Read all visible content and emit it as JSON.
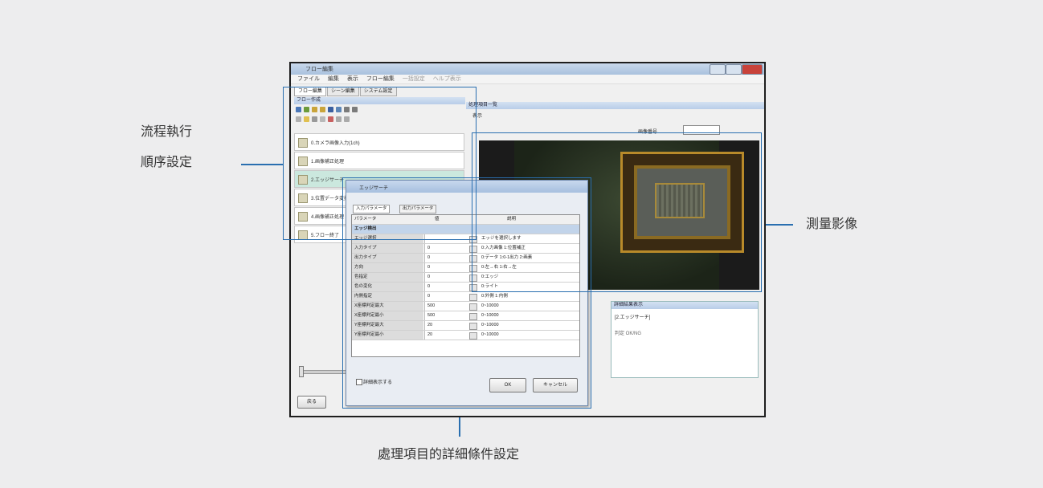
{
  "callouts": {
    "left_line1": "流程執行",
    "left_line2": "順序設定",
    "right": "測量影像",
    "bottom": "處理項目的詳細條件設定"
  },
  "window": {
    "title": "フロー編集",
    "menu": [
      "ファイル",
      "編集",
      "表示",
      "フロー編集",
      "一括設定",
      "ヘルプ表示"
    ],
    "tabs": [
      "フロー編集",
      "シーン編集",
      "システム設定"
    ],
    "left_panel_header": "フロー作成",
    "right_panel_header": "処理項目一覧",
    "right_subheader": "表示",
    "image_number_label": "画像番号",
    "flow_items": [
      "0.カメラ画像入力(1ch)",
      "1.画像補正処理",
      "2.エッジサーチ",
      "3.位置データ変換",
      "4.画像補正処理",
      "5.フロー終了"
    ],
    "result_panel_header": "詳細結果表示",
    "result_line1": "[2.エッジサーチ]",
    "result_line2": "判定 OK/NG",
    "back_button": "戻る"
  },
  "dialog": {
    "title": "エッジサーチ",
    "tabs": [
      "入力パラメータ",
      "出力パラメータ"
    ],
    "columns": [
      "パラメータ",
      "値",
      "説明"
    ],
    "section_label": "エッジ検出",
    "rows": [
      {
        "name": "エッジ選択",
        "value": "",
        "desc": "エッジを選択します"
      },
      {
        "name": "入力タイプ",
        "value": "0",
        "desc": "0:入力画像 1:位置補正"
      },
      {
        "name": "出力タイプ",
        "value": "0",
        "desc": "0:データ 1:0-1出力 2:画素"
      },
      {
        "name": "方向",
        "value": "0",
        "desc": "0:左→右 1:右→左"
      },
      {
        "name": "色指定",
        "value": "0",
        "desc": "0:エッジ"
      },
      {
        "name": "色の変化",
        "value": "0",
        "desc": "0:ライト"
      },
      {
        "name": "内側指定",
        "value": "0",
        "desc": "0:外側 1:内側"
      },
      {
        "name": "X座標判定最大",
        "value": "500",
        "desc": "0~10000"
      },
      {
        "name": "X座標判定最小",
        "value": "500",
        "desc": "0~10000"
      },
      {
        "name": "Y座標判定最大",
        "value": "20",
        "desc": "0~10000"
      },
      {
        "name": "Y座標判定最小",
        "value": "20",
        "desc": "0~10000"
      }
    ],
    "checkbox_label": "詳細表示する",
    "ok": "OK",
    "cancel": "キャンセル"
  },
  "colors": {
    "callout_line": "#2a6fb0",
    "selected_flow": "#cbe8de",
    "panel_header": "#b8cde8",
    "background": "#ededee"
  }
}
